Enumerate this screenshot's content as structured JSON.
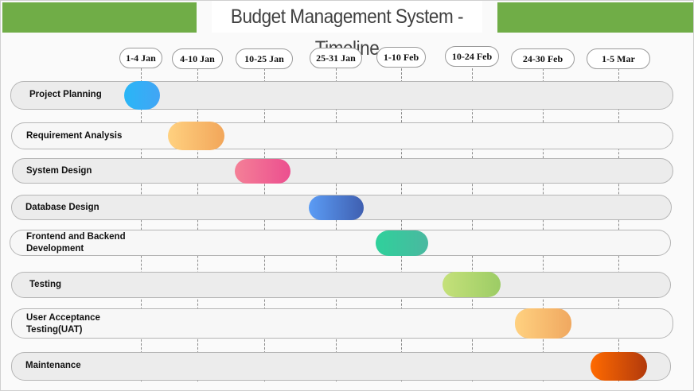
{
  "title": "Budget Management System - Timeline",
  "periods": [
    "1-4 Jan",
    "4-10 Jan",
    "10-25 Jan",
    "25-31 Jan",
    "1-10 Feb",
    "10-24 Feb",
    "24-30 Feb",
    "1-5 Mar"
  ],
  "tasks": [
    {
      "name": "Project Planning",
      "period": "1-4 Jan",
      "color_start": "#29b6f6",
      "color_end": "#42a5f5"
    },
    {
      "name": "Requirement Analysis",
      "period": "4-10 Jan",
      "color_start": "#ffd180",
      "color_end": "#f2a65a"
    },
    {
      "name": "System Design",
      "period": "10-25 Jan",
      "color_start": "#f48097",
      "color_end": "#ec4f8f"
    },
    {
      "name": "Database Design",
      "period": "25-31 Jan",
      "color_start": "#5b9cf5",
      "color_end": "#3f5fb0"
    },
    {
      "name": "Frontend and Backend Development",
      "period": "1-10 Feb",
      "color_start": "#2fd19b",
      "color_end": "#4ab8a0"
    },
    {
      "name": "Testing",
      "period": "10-24 Feb",
      "color_start": "#c5e17a",
      "color_end": "#9ccc65"
    },
    {
      "name": "User Acceptance Testing(UAT)",
      "period": "24-30 Feb",
      "color_start": "#ffd180",
      "color_end": "#f0a860"
    },
    {
      "name": "Maintenance",
      "period": "1-5 Mar",
      "color_start": "#ff6a00",
      "color_end": "#b23a0c"
    }
  ]
}
